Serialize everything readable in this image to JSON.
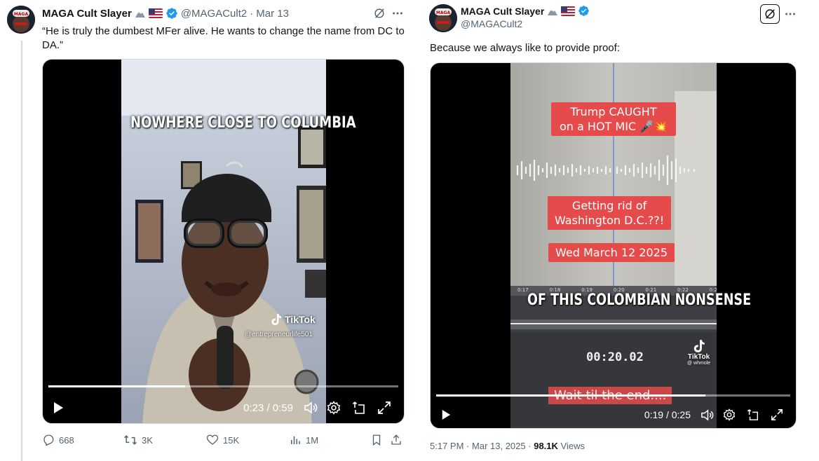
{
  "left_post": {
    "author_name": "MAGA Cult Slayer",
    "handle": "@MAGACult2",
    "separator": "·",
    "date": "Mar 13",
    "text": "“He is truly the dumbest MFer alive. He wants to change the name from DC to DA.”",
    "video": {
      "caption": "NOWHERE CLOSE TO COLUMBIA",
      "watermark_brand": "TikTok",
      "watermark_user": "@entrepreneurlife501",
      "time": "0:23 / 0:59",
      "progress": 0.39
    },
    "actions": {
      "replies": "668",
      "reposts": "3K",
      "likes": "15K",
      "views": "1M"
    }
  },
  "right_post": {
    "author_name": "MAGA Cult Slayer",
    "handle": "@MAGACult2",
    "text": "Because we always like to provide proof:",
    "video": {
      "caption_1_line1": "Trump CAUGHT",
      "caption_1_line2": "on a HOT MIC 🎤💥",
      "caption_2_line1": "Getting rid of",
      "caption_2_line2": "Washington D.C.??!",
      "caption_3": "Wed March 12 2025",
      "subtitle": "OF THIS COLOMBIAN NONSENSE",
      "timeline_ticks": [
        "0:17",
        "0:18",
        "0:19",
        "0:20",
        "0:21",
        "0:22",
        "0:2"
      ],
      "timer": "00:20.02",
      "watermark_brand": "TikTok",
      "watermark_user": "@ whmole",
      "bottom_caption": "Wait til the end....",
      "time": "0:19 / 0:25",
      "progress": 0.76
    },
    "meta": {
      "time": "5:17 PM",
      "separator": "·",
      "date": "Mar 13, 2025",
      "views_count": "98.1K",
      "views_label": "Views"
    }
  },
  "colors": {
    "verified_blue": "#1d9bf0",
    "caption_red": "#e54b4b",
    "text_primary": "#0f1419",
    "text_secondary": "#536471"
  },
  "icons": [
    "grok-icon",
    "more-icon",
    "play-icon",
    "volume-icon",
    "settings-icon",
    "pip-icon",
    "fullscreen-icon",
    "reply-icon",
    "repost-icon",
    "like-icon",
    "views-icon",
    "bookmark-icon",
    "share-icon",
    "tiktok-icon",
    "verified-icon",
    "flag-icon"
  ]
}
